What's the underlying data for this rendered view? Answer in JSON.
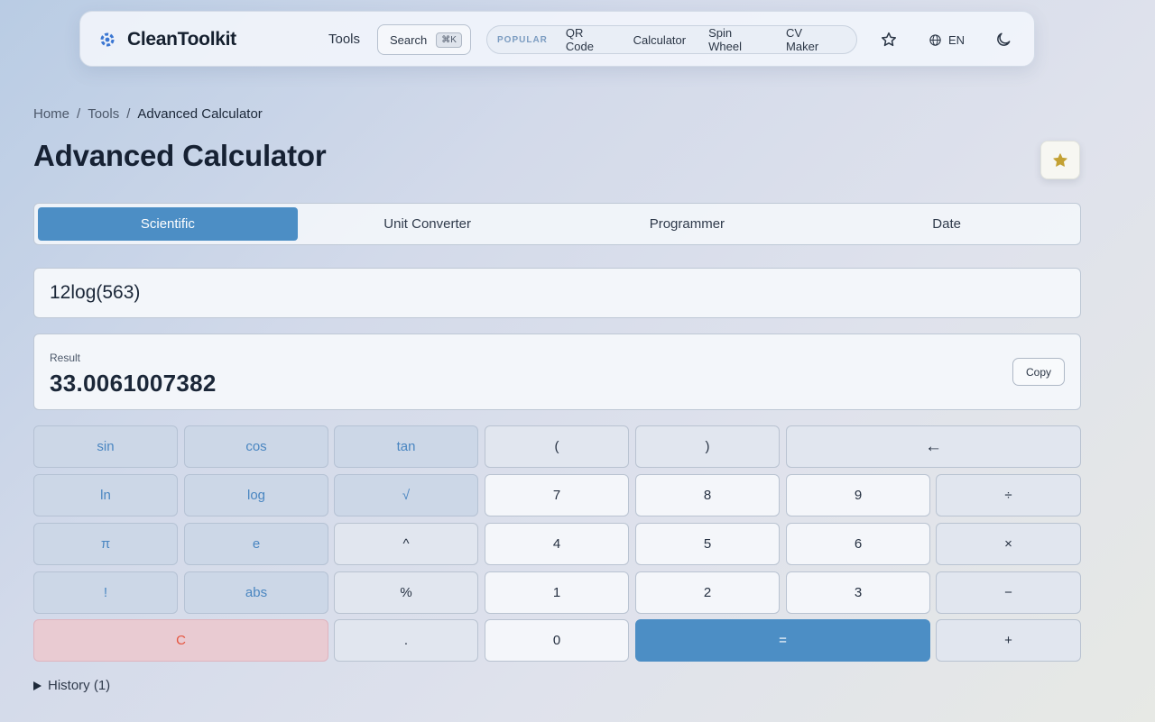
{
  "nav": {
    "brand": "CleanToolkit",
    "tools_label": "Tools",
    "search_label": "Search",
    "search_shortcut": "⌘K",
    "popular_label": "POPULAR",
    "popular_links": [
      "QR Code",
      "Calculator",
      "Spin Wheel",
      "CV Maker"
    ],
    "language": "EN",
    "icons": {
      "brand": "gear-logo-icon",
      "favorites": "star-outline-icon",
      "language": "globe-icon",
      "theme": "moon-icon"
    }
  },
  "breadcrumb": {
    "home": "Home",
    "sep1": "/",
    "tools": "Tools",
    "sep2": "/",
    "current": "Advanced Calculator"
  },
  "page": {
    "title": "Advanced Calculator",
    "favorite_icon": "star-filled-icon"
  },
  "tabs": [
    "Scientific",
    "Unit Converter",
    "Programmer",
    "Date"
  ],
  "active_tab": "Scientific",
  "calculator": {
    "expression": "12log(563)",
    "result_label": "Result",
    "result_value": "33.0061007382",
    "copy_label": "Copy"
  },
  "keys": {
    "sin": "sin",
    "cos": "cos",
    "tan": "tan",
    "lparen": "(",
    "rparen": ")",
    "backspace": "←",
    "ln": "ln",
    "log": "log",
    "sqrt": "√",
    "n7": "7",
    "n8": "8",
    "n9": "9",
    "divide": "÷",
    "pi": "π",
    "e": "e",
    "power": "^",
    "n4": "4",
    "n5": "5",
    "n6": "6",
    "multiply": "×",
    "factorial": "!",
    "abs": "abs",
    "percent": "%",
    "n1": "1",
    "n2": "2",
    "n3": "3",
    "minus": "−",
    "clear": "C",
    "decimal": ".",
    "n0": "0",
    "equals": "=",
    "plus": "+"
  },
  "history": {
    "label": "History (1)"
  },
  "colors": {
    "accent": "#4c8ec5",
    "clear_text": "#e5553f",
    "favorite_star": "#c3a134"
  }
}
